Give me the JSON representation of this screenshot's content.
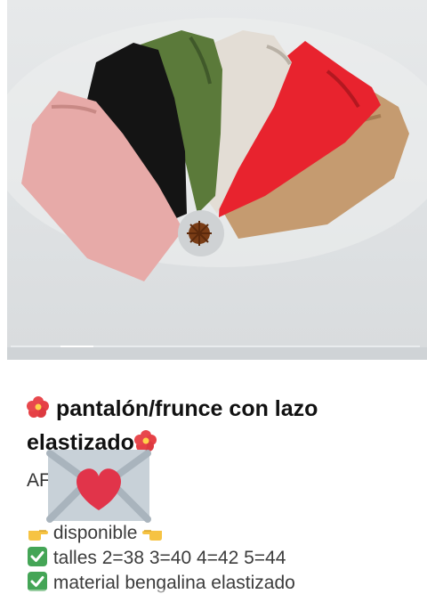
{
  "post": {
    "title_part1": "pantalón/frunce con lazo",
    "title_part2": "elastizado",
    "lead_visible": "AF",
    "availability": "disponible",
    "sizes": "talles 2=38  3=40 4=42  5=44",
    "material": "material bengalina elastizado"
  },
  "media": {
    "carousel_progress": 0.08,
    "pants_colors": [
      "#e7aaa8",
      "#141414",
      "#5b7a3a",
      "#e3ddd5",
      "#e8232e",
      "#c59b70"
    ]
  },
  "icons": {
    "title_emoji": "hibiscus-icon",
    "sticker": "envelope-heart-icon",
    "pointer_left": "pointing-right-hand-icon",
    "pointer_right": "pointing-left-hand-icon",
    "check": "check-box-icon"
  },
  "colors": {
    "check_green": "#44a556",
    "heart_red": "#e1344a",
    "text": "#111111"
  }
}
